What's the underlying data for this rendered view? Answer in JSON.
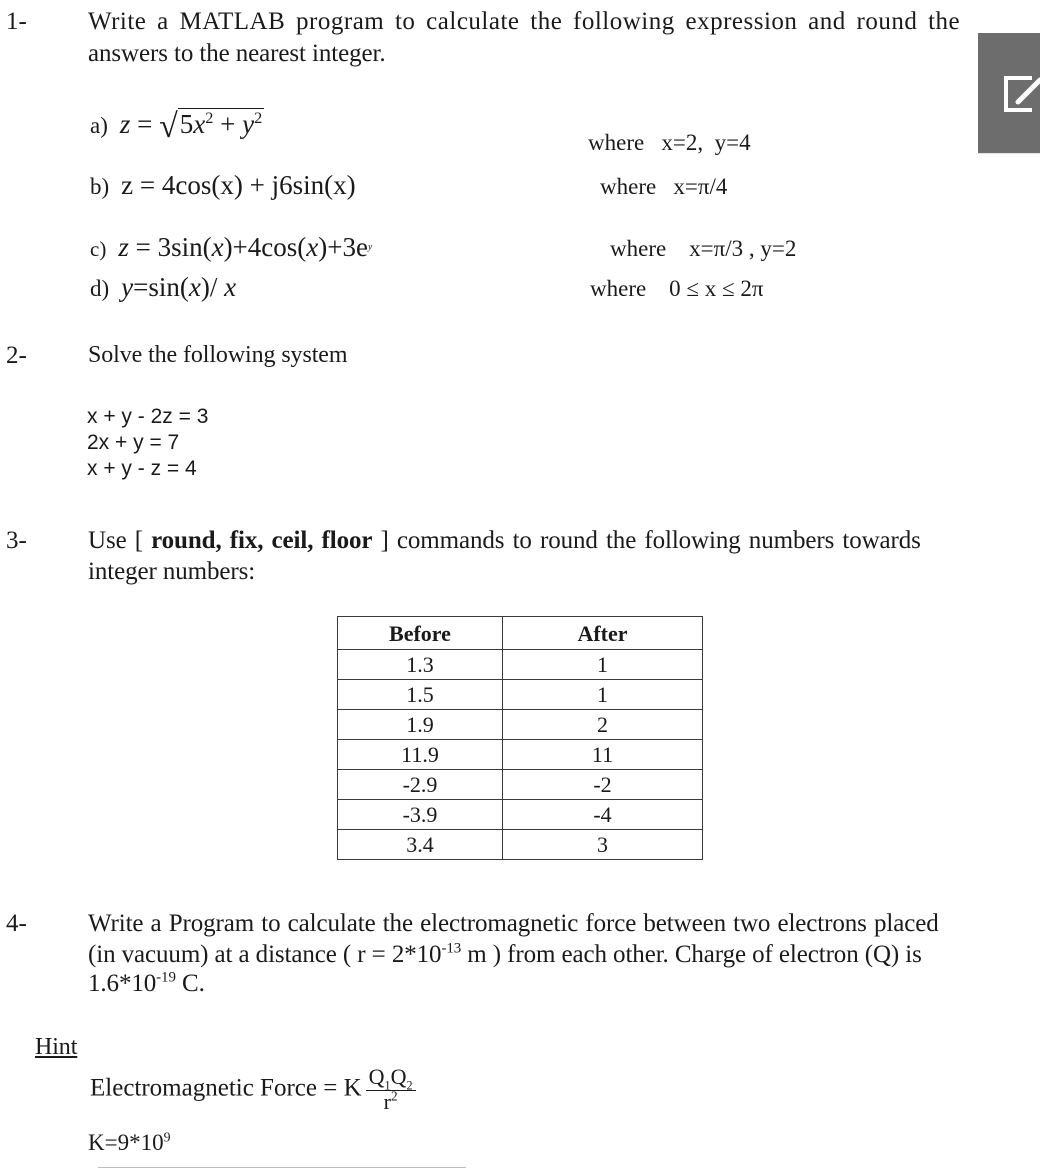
{
  "q1": {
    "number": "1-",
    "line1": "Write a MATLAB program to calculate the following expression and round the",
    "line2": "answers to the nearest integer.",
    "items": [
      {
        "label": "a)",
        "lhs": "z",
        "where": "where   x=2,  y=4"
      },
      {
        "label": "b)",
        "expr": "z = 4cos(x) + j6sin(x)",
        "where": "where   x=π/4"
      },
      {
        "label": "c)",
        "expr_parts": [
          "z",
          " = 3sin(",
          "x",
          ")+4cos(",
          "x",
          ")+3e",
          "y"
        ],
        "where": "where    x=π/3 , y=2"
      },
      {
        "label": "d)",
        "expr_parts": [
          "y",
          "=sin(",
          "x",
          ")/ ",
          "x"
        ],
        "where": "where    0 ≤ x ≤ 2π"
      }
    ],
    "a_expr": {
      "eq": " = ",
      "coef": "5",
      "var1": "x",
      "exp1": "2",
      "plus": " + ",
      "var2": "y",
      "exp2": "2",
      "sqrt": "√"
    }
  },
  "q2": {
    "number": "2-",
    "title": "Solve the following system",
    "equations": [
      "x + y - 2z = 3",
      "2x + y = 7",
      "x + y - z = 4"
    ]
  },
  "q3": {
    "number": "3-",
    "line1_pre": "Use [ ",
    "line1_bold": "round, fix, ceil, floor",
    "line1_post": " ] commands to round the following numbers towards",
    "line2": "integer numbers:",
    "table": {
      "headers": [
        "Before",
        "After"
      ],
      "rows": [
        [
          "1.3",
          "1"
        ],
        [
          "1.5",
          "1"
        ],
        [
          "1.9",
          "2"
        ],
        [
          "11.9",
          "11"
        ],
        [
          "-2.9",
          "-2"
        ],
        [
          "-3.9",
          "-4"
        ],
        [
          "3.4",
          "3"
        ]
      ]
    }
  },
  "q4": {
    "number": "4-",
    "line1": "Write a Program to calculate the electromagnetic force between two electrons placed",
    "line2_pre": "(in vacuum) at a distance ( r = 2*10",
    "line2_exp": "-13",
    "line2_post": " m ) from each other. Charge of electron (Q) is",
    "line3_pre": "1.6*10",
    "line3_exp": "-19",
    "line3_post": " C."
  },
  "hint": {
    "title": "Hint",
    "formula_lhs": "Electromagnetic Force = K",
    "numerator_q1": "Q",
    "numerator_sub1": "1",
    "numerator_q2": "Q",
    "numerator_sub2": "2",
    "denominator": "r",
    "denominator_exp": "2",
    "k_pre": "K=9*10",
    "k_exp": "9"
  },
  "overlay": {
    "icon": "edit-icon",
    "color": "#6d6d6d"
  }
}
